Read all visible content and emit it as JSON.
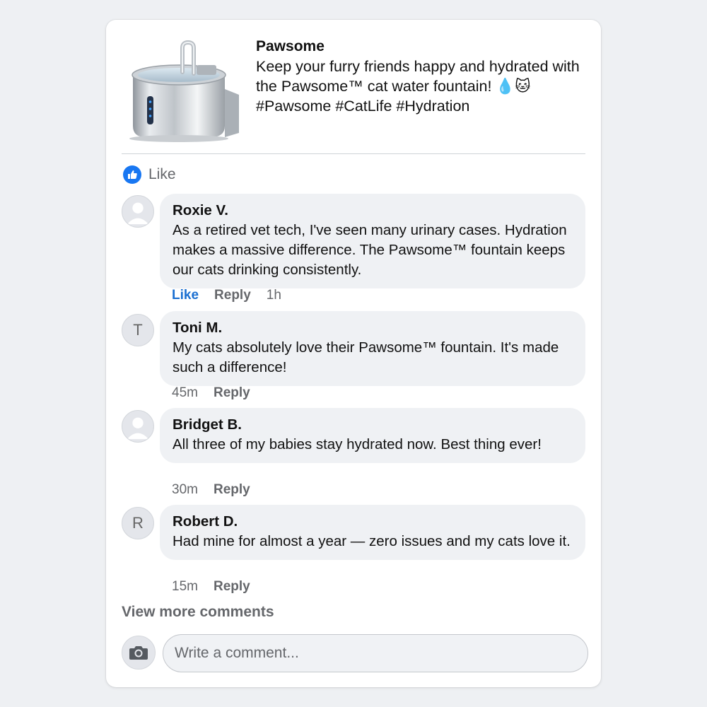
{
  "post": {
    "page_name": "Pawsome",
    "body": "Keep your furry friends happy and hydrated with the Pawsome™ cat water fountain! 💧🐱 #Pawsome #CatLife #Hydration",
    "like_label": "Like"
  },
  "comments": [
    {
      "name": "Roxie V.",
      "text": "As a retired vet tech, I've seen many urinary cases. Hydration makes a massive difference. The Pawsome™ fountain keeps our cats drinking consistently.",
      "avatar": "person-icon",
      "like_label": "Like",
      "reply_label": "Reply",
      "time": "1h"
    },
    {
      "name": "Toni M.",
      "text": "My cats absolutely love their Pawsome™ fountain. It's made such a difference!",
      "avatar_initial": "T",
      "time": "45m",
      "reply_label": "Reply"
    },
    {
      "name": "Bridget B.",
      "text": "All three of my babies stay hydrated now. Best thing ever!",
      "avatar": "person-icon",
      "time": "30m",
      "reply_label": "Reply"
    },
    {
      "name": "Robert D.",
      "text": "Had mine for almost a year — zero issues and my cats love it.",
      "avatar_initial": "R",
      "time": "15m",
      "reply_label": "Reply"
    }
  ],
  "view_more": "View more comments",
  "composer": {
    "placeholder": "Write a comment..."
  },
  "colors": {
    "accent": "#1877f2",
    "like_link": "#1a6fd1",
    "muted": "#65676b",
    "bubble": "#eff1f4"
  }
}
